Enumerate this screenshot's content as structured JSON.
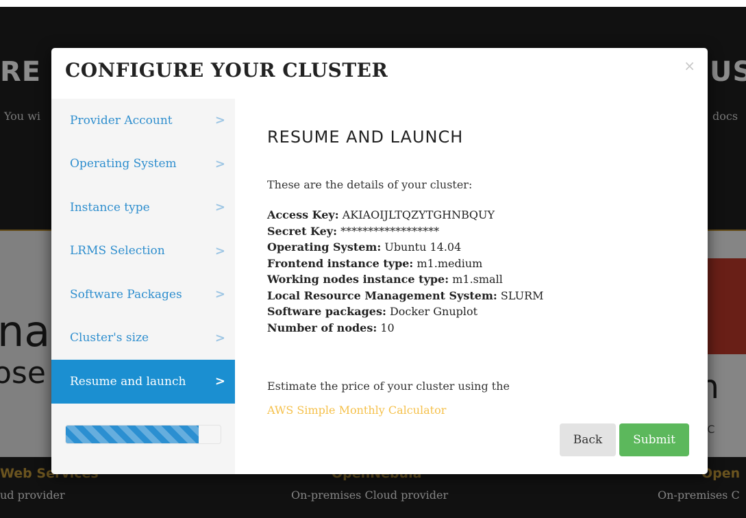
{
  "background": {
    "hero_title_left": "RE",
    "hero_title_right": "US",
    "intro_left": "You wi",
    "intro_right": "docs",
    "left_card_big": "na",
    "left_card_big2": "ose",
    "right_card_big": "en",
    "right_card_small": "JD SC",
    "providers": [
      {
        "name": "Web Services",
        "desc": "ud provider"
      },
      {
        "name": "OpenNebula",
        "desc": "On-premises Cloud provider"
      },
      {
        "name": "Open",
        "desc": "On-premises C"
      }
    ]
  },
  "modal": {
    "title": "CONFIGURE YOUR CLUSTER",
    "close_label": "×",
    "steps": [
      {
        "label": "Provider Account"
      },
      {
        "label": "Operating System"
      },
      {
        "label": "Instance type"
      },
      {
        "label": "LRMS Selection"
      },
      {
        "label": "Software Packages"
      },
      {
        "label": "Cluster's size"
      },
      {
        "label": "Resume and launch"
      }
    ],
    "active_step": 6,
    "chevron": ">",
    "progress_fraction": 0.86,
    "section_title": "RESUME AND LAUNCH",
    "intro": "These are the details of your cluster:",
    "details": [
      {
        "key": "Access Key:",
        "value": "AKIAOIJLTQZYTGHNBQUY"
      },
      {
        "key": "Secret Key:",
        "value": "******************"
      },
      {
        "key": "Operating System:",
        "value": "Ubuntu 14.04"
      },
      {
        "key": "Frontend instance type:",
        "value": "m1.medium"
      },
      {
        "key": "Working nodes instance type:",
        "value": "m1.small"
      },
      {
        "key": "Local Resource Management System:",
        "value": "SLURM"
      },
      {
        "key": "Software packages:",
        "value": "Docker Gnuplot"
      },
      {
        "key": "Number of nodes:",
        "value": "10"
      }
    ],
    "estimate_text": "Estimate the price of your cluster using the",
    "calculator_link": "AWS Simple Monthly Calculator",
    "back_label": "Back",
    "submit_label": "Submit"
  },
  "colors": {
    "accent": "#1b8fd1",
    "link": "#2e8ece",
    "submit": "#5cb85c",
    "calc_link": "#f5c04a"
  }
}
